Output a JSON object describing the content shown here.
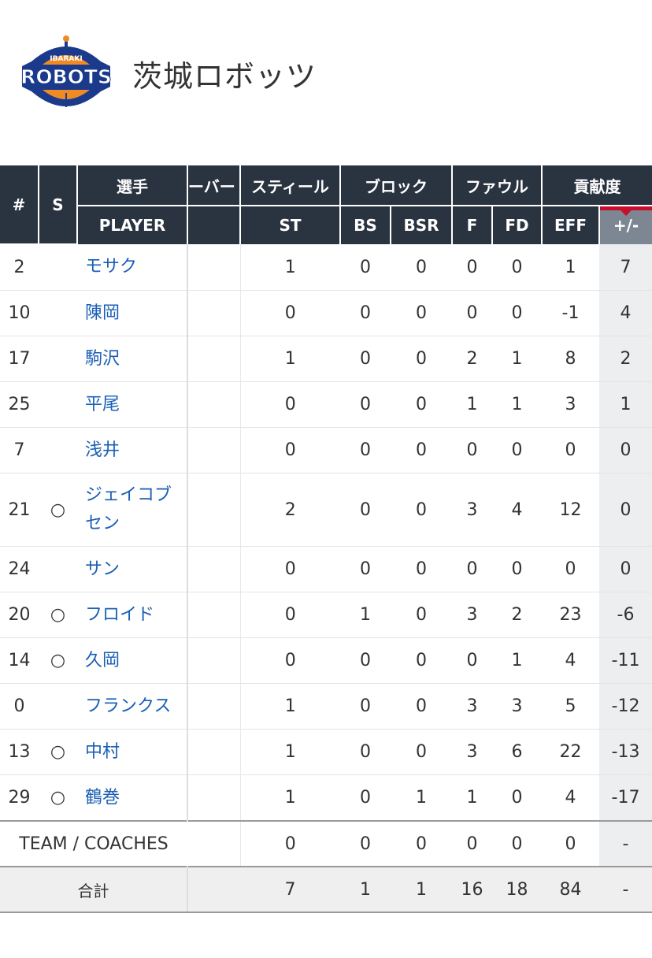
{
  "team": {
    "name": "茨城ロボッツ",
    "logo_main": "ROBOTS",
    "logo_sub": "IBARAKI",
    "colors": {
      "navy": "#1b3a8c",
      "orange": "#f08a24"
    }
  },
  "table": {
    "headers": {
      "number": "#",
      "starter": "S",
      "player_group": "選手",
      "player": "PLAYER",
      "turnover_partial": "ーバー",
      "steal_group": "スティール",
      "steal": "ST",
      "block_group": "ブロック",
      "block": "BS",
      "block_received": "BSR",
      "foul_group": "ファウル",
      "foul": "F",
      "foul_drawn": "FD",
      "contribution_group": "貢献度",
      "efficiency": "EFF",
      "plus_minus": "+/-"
    },
    "rows": [
      {
        "no": "2",
        "s": "",
        "player": "モサク",
        "st": "1",
        "bs": "0",
        "bsr": "0",
        "f": "0",
        "fd": "0",
        "eff": "1",
        "pm": "7"
      },
      {
        "no": "10",
        "s": "",
        "player": "陳岡",
        "st": "0",
        "bs": "0",
        "bsr": "0",
        "f": "0",
        "fd": "0",
        "eff": "-1",
        "pm": "4"
      },
      {
        "no": "17",
        "s": "",
        "player": "駒沢",
        "st": "1",
        "bs": "0",
        "bsr": "0",
        "f": "2",
        "fd": "1",
        "eff": "8",
        "pm": "2"
      },
      {
        "no": "25",
        "s": "",
        "player": "平尾",
        "st": "0",
        "bs": "0",
        "bsr": "0",
        "f": "1",
        "fd": "1",
        "eff": "3",
        "pm": "1"
      },
      {
        "no": "7",
        "s": "",
        "player": "浅井",
        "st": "0",
        "bs": "0",
        "bsr": "0",
        "f": "0",
        "fd": "0",
        "eff": "0",
        "pm": "0"
      },
      {
        "no": "21",
        "s": "○",
        "player": "ジェイコブセン",
        "st": "2",
        "bs": "0",
        "bsr": "0",
        "f": "3",
        "fd": "4",
        "eff": "12",
        "pm": "0"
      },
      {
        "no": "24",
        "s": "",
        "player": "サン",
        "st": "0",
        "bs": "0",
        "bsr": "0",
        "f": "0",
        "fd": "0",
        "eff": "0",
        "pm": "0"
      },
      {
        "no": "20",
        "s": "○",
        "player": "フロイド",
        "st": "0",
        "bs": "1",
        "bsr": "0",
        "f": "3",
        "fd": "2",
        "eff": "23",
        "pm": "-6"
      },
      {
        "no": "14",
        "s": "○",
        "player": "久岡",
        "st": "0",
        "bs": "0",
        "bsr": "0",
        "f": "0",
        "fd": "1",
        "eff": "4",
        "pm": "-11"
      },
      {
        "no": "0",
        "s": "",
        "player": "フランクス",
        "st": "1",
        "bs": "0",
        "bsr": "0",
        "f": "3",
        "fd": "3",
        "eff": "5",
        "pm": "-12"
      },
      {
        "no": "13",
        "s": "○",
        "player": "中村",
        "st": "1",
        "bs": "0",
        "bsr": "0",
        "f": "3",
        "fd": "6",
        "eff": "22",
        "pm": "-13"
      },
      {
        "no": "29",
        "s": "○",
        "player": "鶴巻",
        "st": "1",
        "bs": "0",
        "bsr": "1",
        "f": "1",
        "fd": "0",
        "eff": "4",
        "pm": "-17"
      }
    ],
    "team_row": {
      "label": "TEAM / COACHES",
      "st": "0",
      "bs": "0",
      "bsr": "0",
      "f": "0",
      "fd": "0",
      "eff": "0",
      "pm": "-"
    },
    "total_row": {
      "label": "合計",
      "st": "7",
      "bs": "1",
      "bsr": "1",
      "f": "16",
      "fd": "18",
      "eff": "84",
      "pm": "-"
    }
  }
}
